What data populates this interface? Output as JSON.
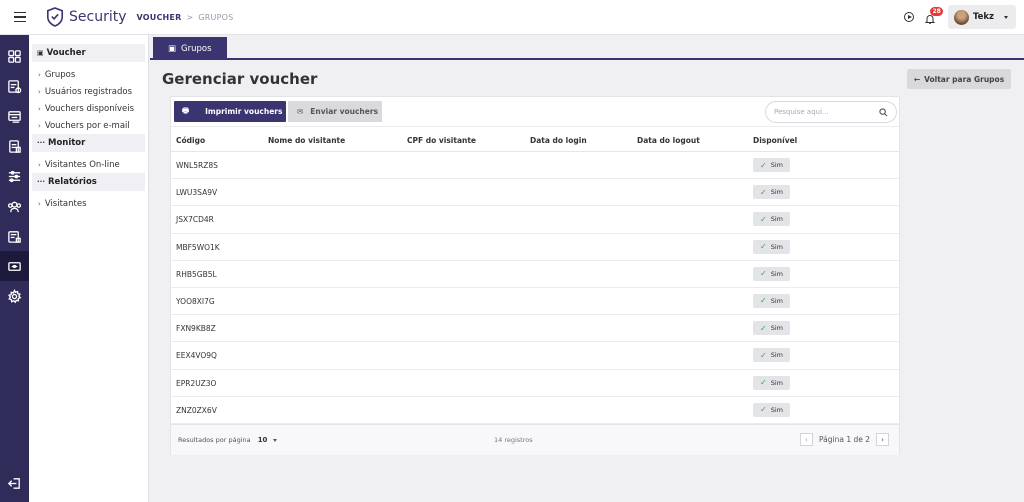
{
  "header": {
    "brand": "Security",
    "breadcrumb_main": "VOUCHER",
    "breadcrumb_sep": ">",
    "breadcrumb_sub": "GRUPOS",
    "notifications_count": "28",
    "user_name": "Tekz"
  },
  "rail": {
    "icons": [
      "dashboard-icon",
      "devices-icon",
      "access-icon",
      "reports-icon",
      "filters-icon",
      "users-group-icon",
      "secure-docs-icon",
      "voucher-icon",
      "settings-icon",
      "logout-icon"
    ],
    "active": "voucher-icon"
  },
  "nav": {
    "voucher_header": "Voucher",
    "voucher_items": [
      "Grupos",
      "Usuários registrados",
      "Vouchers disponíveis",
      "Vouchers por e-mail"
    ],
    "monitor_header": "Monitor",
    "monitor_items": [
      "Visitantes On-line"
    ],
    "reports_header": "Relatórios",
    "reports_items": [
      "Visitantes"
    ]
  },
  "tab": {
    "label": "Grupos"
  },
  "page": {
    "title": "Gerenciar voucher",
    "back_button": "Voltar para Grupos"
  },
  "toolbar": {
    "print_label": "Imprimir vouchers",
    "send_label": "Enviar vouchers",
    "search_placeholder": "Pesquise aqui..."
  },
  "table": {
    "columns": [
      "Código",
      "Nome do visitante",
      "CPF do visitante",
      "Data do login",
      "Data do logout",
      "Disponível"
    ],
    "rows": [
      {
        "code": "WNL5RZ8S",
        "available": "Sim"
      },
      {
        "code": "LWU3SA9V",
        "available": "Sim"
      },
      {
        "code": "JSX7CD4R",
        "available": "Sim"
      },
      {
        "code": "MBF5WO1K",
        "available": "Sim"
      },
      {
        "code": "RHB5GB5L",
        "available": "Sim"
      },
      {
        "code": "YOO8XI7G",
        "available": "Sim"
      },
      {
        "code": "FXN9KB8Z",
        "available": "Sim"
      },
      {
        "code": "EEX4VO9Q",
        "available": "Sim"
      },
      {
        "code": "EPR2UZ3O",
        "available": "Sim"
      },
      {
        "code": "ZNZ0ZX6V",
        "available": "Sim"
      }
    ]
  },
  "footer": {
    "per_page_label": "Resultados por página",
    "per_page_value": "10",
    "total": "14 registros",
    "page_info": "Página 1 de 2"
  },
  "colors": {
    "primary": "#3a3570",
    "rail": "#2f2c5a",
    "success": "#3ea34a",
    "badge": "#e53935"
  }
}
